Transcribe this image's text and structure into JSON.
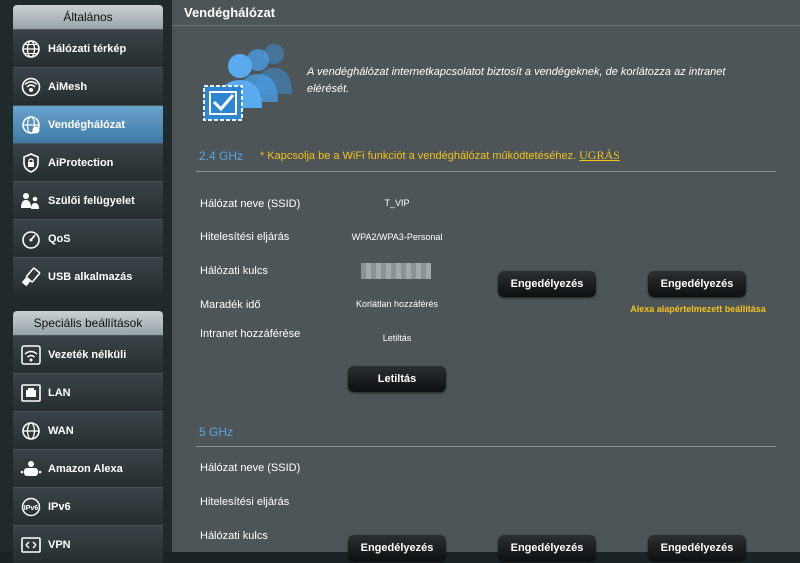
{
  "sidebar": {
    "general_header": "Általános",
    "general_items": [
      {
        "label": "Hálózati térkép",
        "icon": "globe-icon"
      },
      {
        "label": "AiMesh",
        "icon": "mesh-icon"
      },
      {
        "label": "Vendéghálózat",
        "icon": "guest-network-icon",
        "active": true
      },
      {
        "label": "AiProtection",
        "icon": "lock-shield-icon"
      },
      {
        "label": "Szülői felügyelet",
        "icon": "family-icon"
      },
      {
        "label": "QoS",
        "icon": "speedometer-icon"
      },
      {
        "label": "USB alkalmazás",
        "icon": "usb-icon"
      }
    ],
    "advanced_header": "Speciális beállítások",
    "advanced_items": [
      {
        "label": "Vezeték nélküli",
        "icon": "wifi-icon"
      },
      {
        "label": "LAN",
        "icon": "lan-icon"
      },
      {
        "label": "WAN",
        "icon": "wan-globe-icon"
      },
      {
        "label": "Amazon Alexa",
        "icon": "alexa-icon"
      },
      {
        "label": "IPv6",
        "icon": "ipv6-icon"
      },
      {
        "label": "VPN",
        "icon": "vpn-icon"
      }
    ]
  },
  "main": {
    "title": "Vendéghálózat",
    "description": "A vendéghálózat internetkapcsolatot biztosít a vendégeknek, de korlátozza az intranet elérését.",
    "band24": {
      "label": "2.4 GHz",
      "note": "* Kapcsolja be a WiFi funkciót a vendéghálózat működtetéséhez.",
      "note_link": "UGRÁS",
      "fields": {
        "ssid_label": "Hálózat neve (SSID)",
        "ssid_value": "T_VIP",
        "auth_label": "Hitelesítési eljárás",
        "auth_value": "WPA2/WPA3-Personal",
        "key_label": "Hálózati kulcs",
        "time_label": "Maradék idő",
        "time_value": "Korlátlan hozzáférés",
        "intranet_label": "Intranet hozzáférése",
        "intranet_value": "Letiltás"
      },
      "disable_button": "Letiltás",
      "enable_button_1": "Engedélyezés",
      "enable_button_2": "Engedélyezés",
      "alexa_note": "Alexa alapértelmezett beállítása"
    },
    "band5": {
      "label": "5 GHz",
      "fields": {
        "ssid_label": "Hálózat neve (SSID)",
        "auth_label": "Hitelesítési eljárás",
        "key_label": "Hálózati kulcs"
      },
      "enable_button_1": "Engedélyezés",
      "enable_button_2": "Engedélyezés",
      "enable_button_3": "Engedélyezés"
    }
  },
  "colors": {
    "accent_blue": "#57a7df",
    "note_yellow": "#f2c21b",
    "active_item": "#4f8dbd"
  }
}
